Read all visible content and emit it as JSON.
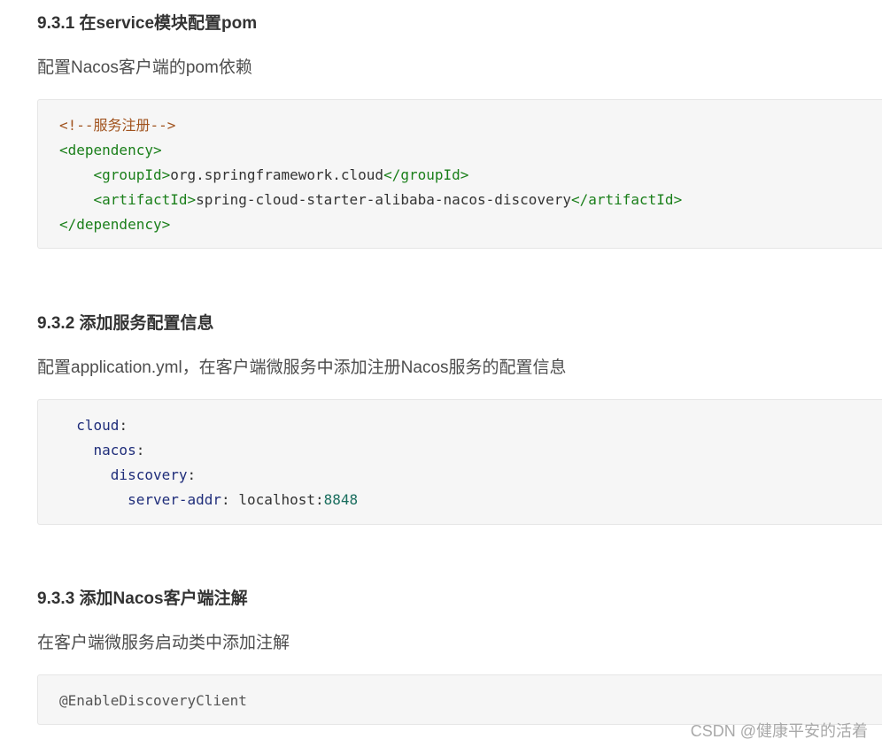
{
  "section1": {
    "heading": "9.3.1 在service模块配置pom",
    "description": "配置Nacos客户端的pom依赖",
    "code": {
      "comment": "<!--服务注册-->",
      "dep_open": "<dependency>",
      "group_open": "<groupId>",
      "group_value": "org.springframework.cloud",
      "group_close": "</groupId>",
      "artifact_open": "<artifactId>",
      "artifact_value": "spring-cloud-starter-alibaba-nacos-discovery",
      "artifact_close": "</artifactId>",
      "dep_close": "</dependency>"
    }
  },
  "section2": {
    "heading": "9.3.2 添加服务配置信息",
    "description": "配置application.yml，在客户端微服务中添加注册Nacos服务的配置信息",
    "code": {
      "k1": "cloud",
      "k2": "nacos",
      "k3": "discovery",
      "k4": "server-addr",
      "colon": ":",
      "host": "localhost:",
      "port": "8848"
    }
  },
  "section3": {
    "heading": "9.3.3 添加Nacos客户端注解",
    "description": "在客户端微服务启动类中添加注解",
    "code": {
      "annotation": "@EnableDiscoveryClient"
    }
  },
  "watermark": "CSDN @健康平安的活着"
}
